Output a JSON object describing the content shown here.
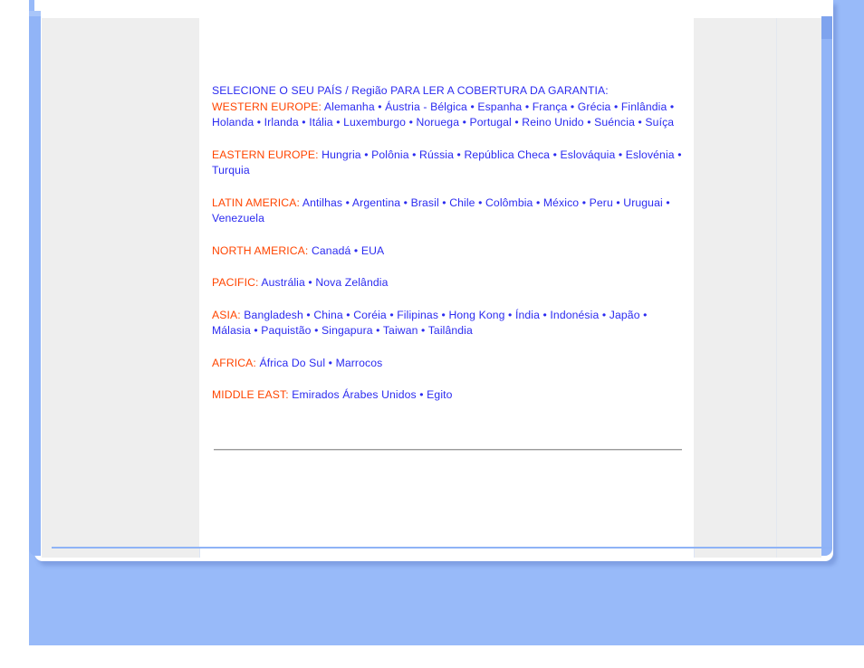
{
  "page": {
    "heading": "SELECIONE O SEU PAÍS / Região PARA LER A COBERTURA DA GARANTIA:",
    "separator": " • ",
    "colors": {
      "region_label": "#ff4500",
      "country_link": "#2b2bf0",
      "heading": "#2b2bf0",
      "backdrop": "#98baf9",
      "accent_bar": "#91b4f7",
      "sidebar": "#eeeeee",
      "rule": "#9a9a9a"
    }
  },
  "regions": [
    {
      "label": "WESTERN EUROPE:",
      "countries": [
        "Alemanha",
        "Áustria - Bélgica",
        "Espanha",
        "França",
        "Grécia",
        "Finlândia",
        "Holanda",
        "Irlanda",
        "Itália",
        "Luxemburgo",
        "Noruega",
        "Portugal",
        "Reino Unido",
        "Suéncia",
        "Suíça"
      ]
    },
    {
      "label": "EASTERN EUROPE:",
      "countries": [
        "Hungria",
        "Polônia",
        "Rússia",
        "República Checa",
        "Eslováquia",
        "Eslovénia",
        "Turquia"
      ]
    },
    {
      "label": "LATIN AMERICA:",
      "countries": [
        "Antilhas",
        "Argentina",
        "Brasil",
        "Chile",
        "Colômbia",
        "México",
        "Peru",
        "Uruguai",
        "Venezuela"
      ]
    },
    {
      "label": "NORTH AMERICA:",
      "countries": [
        "Canadá",
        "EUA"
      ]
    },
    {
      "label": "PACIFIC:",
      "countries": [
        "Austrália",
        "Nova Zelândia"
      ]
    },
    {
      "label": "ASIA:",
      "countries": [
        "Bangladesh",
        "China",
        "Coréia",
        "Filipinas",
        "Hong Kong",
        "Índia",
        "Indonésia",
        "Japão",
        "Málasia",
        "Paquistão",
        "Singapura",
        "Taiwan",
        "Tailândia"
      ]
    },
    {
      "label": "AFRICA:",
      "countries": [
        "África Do Sul",
        "Marrocos"
      ]
    },
    {
      "label": "MIDDLE EAST:",
      "countries": [
        "Emirados Árabes Unidos",
        "Egito"
      ]
    }
  ]
}
